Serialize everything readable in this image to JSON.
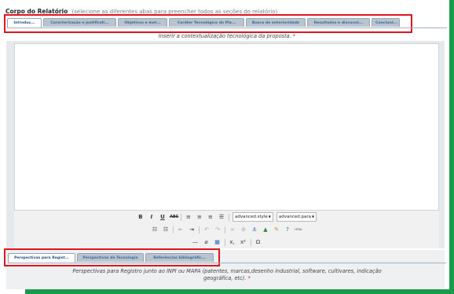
{
  "section": {
    "title": "Corpo do Relatório",
    "hint": "(selecione as diferentes abas para preencher todos as seções do relatório)"
  },
  "top_tabs": [
    {
      "label": "Introduç...",
      "active": true
    },
    {
      "label": "Caracterização e justificati...",
      "active": false
    },
    {
      "label": "Objetivos e met...",
      "active": false
    },
    {
      "label": "Caráter Tecnológico do Pla...",
      "active": false
    },
    {
      "label": "Busca de anterioridade",
      "active": false
    },
    {
      "label": "Resultados e discussõ...",
      "active": false
    },
    {
      "label": "Conclusõ...",
      "active": false
    }
  ],
  "editor": {
    "instruction": "Inserir a contextualização tecnológica da proposta.",
    "required_marker": "*",
    "content": "",
    "toolbar": {
      "style_select": "advanced.style",
      "para_select": "advanced.para",
      "html_label": "HTML"
    }
  },
  "bottom_tabs": [
    {
      "label": "Perspectivas para Regist...",
      "active": true
    },
    {
      "label": "Perspectivas de Tecnologia",
      "active": false
    },
    {
      "label": "Referências bibliográfic...",
      "active": false
    }
  ],
  "bottom": {
    "instruction_line1": "Perspectivas para Registro junto ao INPI ou MAPA (patentes, marcas,desenho industrial, software, cultivares, indicação",
    "instruction_line2": "geográfica, etc).",
    "required_marker": "*"
  },
  "colors": {
    "accent_green": "#1a9a4a",
    "highlight_red": "#e0151c",
    "tab_text": "#3b6a98"
  }
}
